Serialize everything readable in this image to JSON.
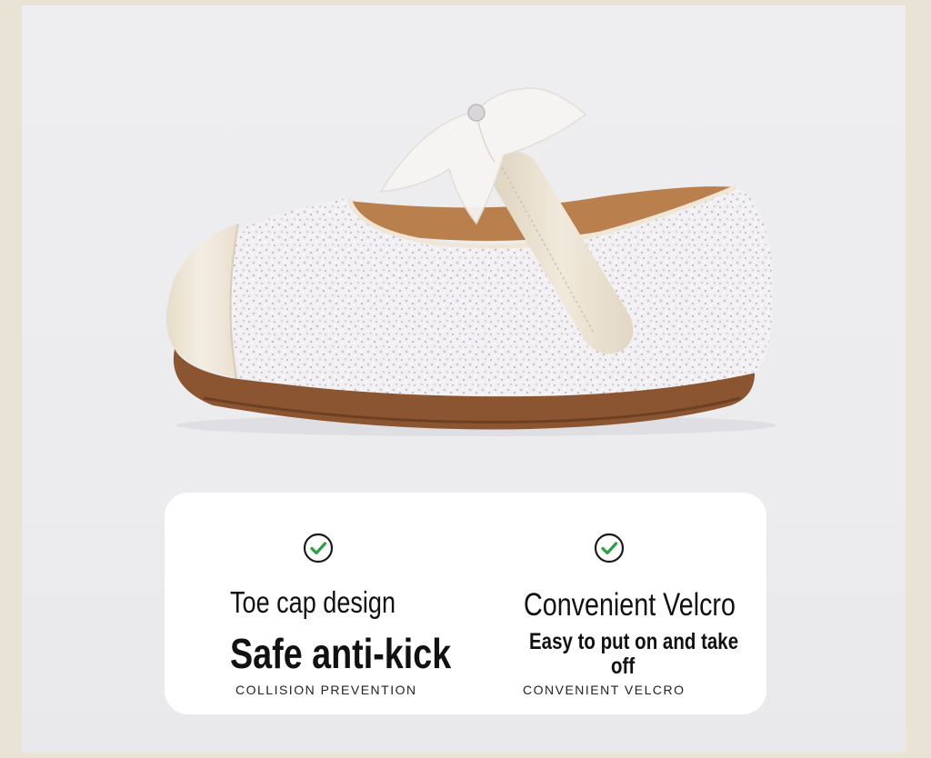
{
  "features": [
    {
      "icon": "check-circle-icon",
      "heading": "Toe cap design",
      "tagline": "Safe anti-kick",
      "caption": "COLLISION PREVENTION"
    },
    {
      "icon": "check-circle-icon",
      "heading": "Convenient Velcro",
      "tagline_line1": "Easy to put on and take",
      "tagline_line2": "off",
      "caption": "CONVENIENT VELCRO"
    }
  ],
  "colors": {
    "page_border": "#e9e3d6",
    "background": "#eeeef0",
    "card": "#ffffff",
    "check_green": "#2e9e3e",
    "sole": "#8a5530",
    "toe_cap": "#efe6d8"
  }
}
